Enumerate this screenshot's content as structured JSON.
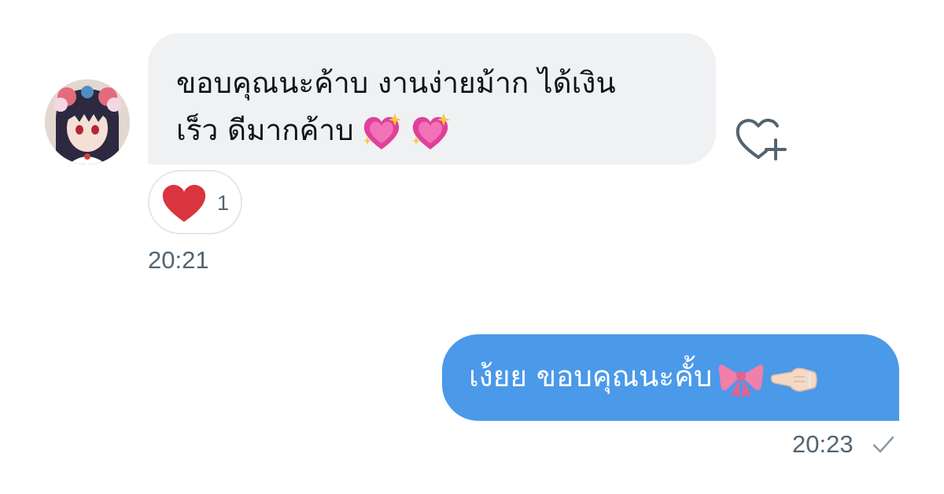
{
  "incoming": {
    "text_line1": "ขอบคุณนะค้าบ งานง่ายม้าก ได้เงิน",
    "text_line2": "เร็ว ดีมากค้าบ",
    "emojis": [
      "sparkling-heart",
      "sparkling-heart"
    ],
    "reaction": {
      "emoji": "red-heart",
      "count": "1"
    },
    "time": "20:21"
  },
  "outgoing": {
    "text": "เง้ยย ขอบคุณนะคั้บ",
    "emojis": [
      "ribbon-bow",
      "hand-pointing-left"
    ],
    "time": "20:23",
    "status": "sent-check"
  },
  "colors": {
    "incoming_bubble": "#eff1f3",
    "outgoing_bubble": "#4b99e9",
    "timestamp": "#536471",
    "heart_red": "#d9343f"
  }
}
